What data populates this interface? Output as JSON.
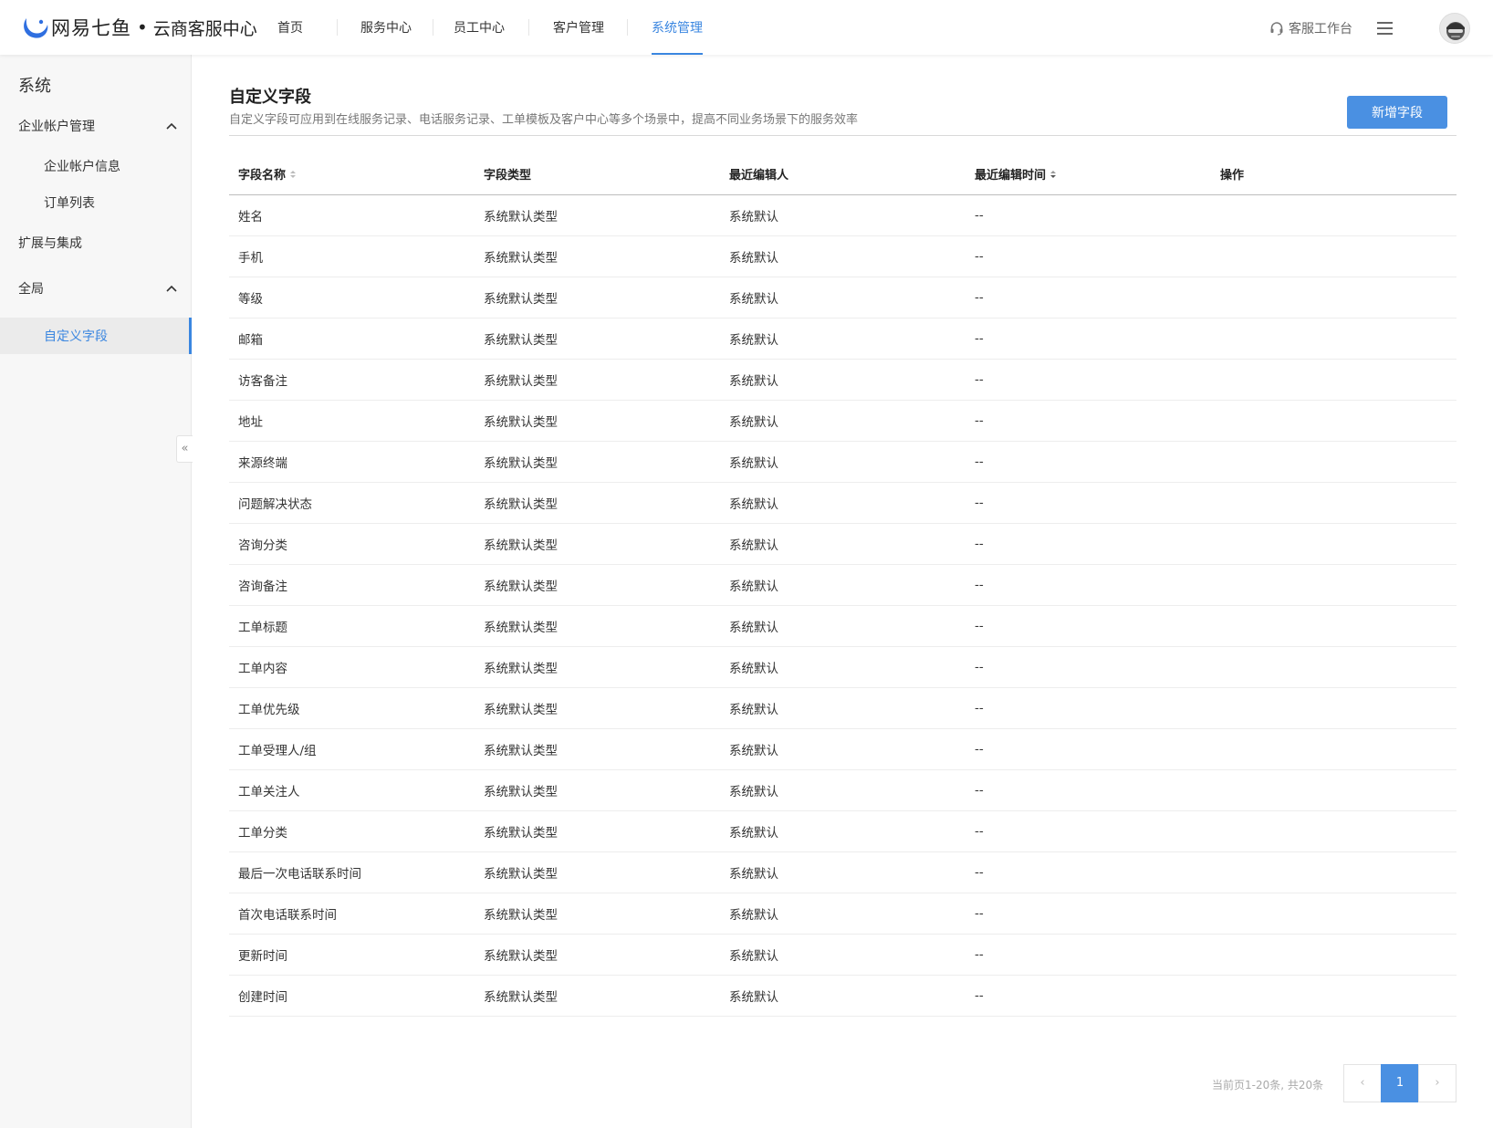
{
  "header": {
    "brand": "网易七鱼",
    "separator": "•",
    "product": "云商客服中心",
    "nav": [
      {
        "label": "首页",
        "active": false
      },
      {
        "label": "服务中心",
        "active": false
      },
      {
        "label": "员工中心",
        "active": false
      },
      {
        "label": "客户管理",
        "active": false
      },
      {
        "label": "系统管理",
        "active": true
      }
    ],
    "workbench_label": "客服工作台",
    "accent_color": "#3a86e0"
  },
  "sidebar": {
    "title": "系统",
    "groups": [
      {
        "label": "企业帐户管理",
        "expanded": true,
        "items": [
          {
            "label": "企业帐户信息"
          },
          {
            "label": "订单列表"
          }
        ]
      },
      {
        "label": "扩展与集成"
      },
      {
        "label": "全局",
        "expanded": true,
        "items": [
          {
            "label": "自定义字段",
            "active": true
          }
        ]
      }
    ],
    "collapse_icon": "«"
  },
  "main": {
    "title": "自定义字段",
    "description": "自定义字段可应用到在线服务记录、电话服务记录、工单模板及客户中心等多个场景中，提高不同业务场景下的服务效率",
    "add_button": "新增字段",
    "table": {
      "columns": [
        "字段名称",
        "字段类型",
        "最近编辑人",
        "最近编辑时间",
        "操作"
      ],
      "rows": [
        [
          "姓名",
          "系统默认类型",
          "系统默认",
          "--",
          ""
        ],
        [
          "手机",
          "系统默认类型",
          "系统默认",
          "--",
          ""
        ],
        [
          "等级",
          "系统默认类型",
          "系统默认",
          "--",
          ""
        ],
        [
          "邮箱",
          "系统默认类型",
          "系统默认",
          "--",
          ""
        ],
        [
          "访客备注",
          "系统默认类型",
          "系统默认",
          "--",
          ""
        ],
        [
          "地址",
          "系统默认类型",
          "系统默认",
          "--",
          ""
        ],
        [
          "来源终端",
          "系统默认类型",
          "系统默认",
          "--",
          ""
        ],
        [
          "问题解决状态",
          "系统默认类型",
          "系统默认",
          "--",
          ""
        ],
        [
          "咨询分类",
          "系统默认类型",
          "系统默认",
          "--",
          ""
        ],
        [
          "咨询备注",
          "系统默认类型",
          "系统默认",
          "--",
          ""
        ],
        [
          "工单标题",
          "系统默认类型",
          "系统默认",
          "--",
          ""
        ],
        [
          "工单内容",
          "系统默认类型",
          "系统默认",
          "--",
          ""
        ],
        [
          "工单优先级",
          "系统默认类型",
          "系统默认",
          "--",
          ""
        ],
        [
          "工单受理人/组",
          "系统默认类型",
          "系统默认",
          "--",
          ""
        ],
        [
          "工单关注人",
          "系统默认类型",
          "系统默认",
          "--",
          ""
        ],
        [
          "工单分类",
          "系统默认类型",
          "系统默认",
          "--",
          ""
        ],
        [
          "最后一次电话联系时间",
          "系统默认类型",
          "系统默认",
          "--",
          ""
        ],
        [
          "首次电话联系时间",
          "系统默认类型",
          "系统默认",
          "--",
          ""
        ],
        [
          "更新时间",
          "系统默认类型",
          "系统默认",
          "--",
          ""
        ],
        [
          "创建时间",
          "系统默认类型",
          "系统默认",
          "--",
          ""
        ]
      ]
    },
    "pagination": {
      "info": "当前页1-20条, 共20条",
      "prev": "‹",
      "current": "1",
      "next": "›"
    }
  }
}
